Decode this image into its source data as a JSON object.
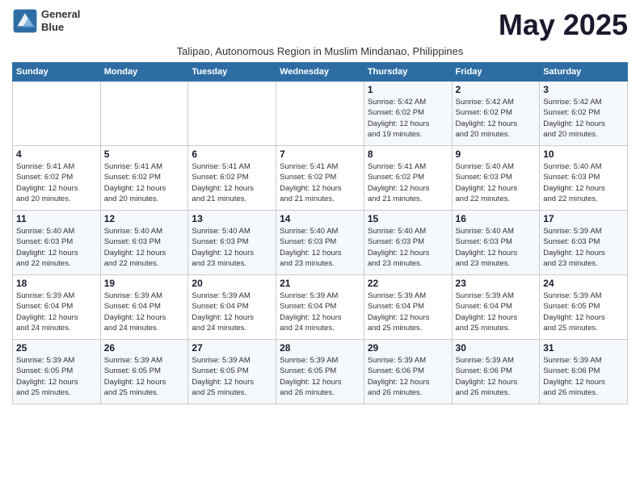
{
  "logo": {
    "line1": "General",
    "line2": "Blue"
  },
  "title": "May 2025",
  "subtitle": "Talipao, Autonomous Region in Muslim Mindanao, Philippines",
  "weekdays": [
    "Sunday",
    "Monday",
    "Tuesday",
    "Wednesday",
    "Thursday",
    "Friday",
    "Saturday"
  ],
  "weeks": [
    [
      {
        "day": "",
        "info": ""
      },
      {
        "day": "",
        "info": ""
      },
      {
        "day": "",
        "info": ""
      },
      {
        "day": "",
        "info": ""
      },
      {
        "day": "1",
        "info": "Sunrise: 5:42 AM\nSunset: 6:02 PM\nDaylight: 12 hours\nand 19 minutes."
      },
      {
        "day": "2",
        "info": "Sunrise: 5:42 AM\nSunset: 6:02 PM\nDaylight: 12 hours\nand 20 minutes."
      },
      {
        "day": "3",
        "info": "Sunrise: 5:42 AM\nSunset: 6:02 PM\nDaylight: 12 hours\nand 20 minutes."
      }
    ],
    [
      {
        "day": "4",
        "info": "Sunrise: 5:41 AM\nSunset: 6:02 PM\nDaylight: 12 hours\nand 20 minutes."
      },
      {
        "day": "5",
        "info": "Sunrise: 5:41 AM\nSunset: 6:02 PM\nDaylight: 12 hours\nand 20 minutes."
      },
      {
        "day": "6",
        "info": "Sunrise: 5:41 AM\nSunset: 6:02 PM\nDaylight: 12 hours\nand 21 minutes."
      },
      {
        "day": "7",
        "info": "Sunrise: 5:41 AM\nSunset: 6:02 PM\nDaylight: 12 hours\nand 21 minutes."
      },
      {
        "day": "8",
        "info": "Sunrise: 5:41 AM\nSunset: 6:02 PM\nDaylight: 12 hours\nand 21 minutes."
      },
      {
        "day": "9",
        "info": "Sunrise: 5:40 AM\nSunset: 6:03 PM\nDaylight: 12 hours\nand 22 minutes."
      },
      {
        "day": "10",
        "info": "Sunrise: 5:40 AM\nSunset: 6:03 PM\nDaylight: 12 hours\nand 22 minutes."
      }
    ],
    [
      {
        "day": "11",
        "info": "Sunrise: 5:40 AM\nSunset: 6:03 PM\nDaylight: 12 hours\nand 22 minutes."
      },
      {
        "day": "12",
        "info": "Sunrise: 5:40 AM\nSunset: 6:03 PM\nDaylight: 12 hours\nand 22 minutes."
      },
      {
        "day": "13",
        "info": "Sunrise: 5:40 AM\nSunset: 6:03 PM\nDaylight: 12 hours\nand 23 minutes."
      },
      {
        "day": "14",
        "info": "Sunrise: 5:40 AM\nSunset: 6:03 PM\nDaylight: 12 hours\nand 23 minutes."
      },
      {
        "day": "15",
        "info": "Sunrise: 5:40 AM\nSunset: 6:03 PM\nDaylight: 12 hours\nand 23 minutes."
      },
      {
        "day": "16",
        "info": "Sunrise: 5:40 AM\nSunset: 6:03 PM\nDaylight: 12 hours\nand 23 minutes."
      },
      {
        "day": "17",
        "info": "Sunrise: 5:39 AM\nSunset: 6:03 PM\nDaylight: 12 hours\nand 23 minutes."
      }
    ],
    [
      {
        "day": "18",
        "info": "Sunrise: 5:39 AM\nSunset: 6:04 PM\nDaylight: 12 hours\nand 24 minutes."
      },
      {
        "day": "19",
        "info": "Sunrise: 5:39 AM\nSunset: 6:04 PM\nDaylight: 12 hours\nand 24 minutes."
      },
      {
        "day": "20",
        "info": "Sunrise: 5:39 AM\nSunset: 6:04 PM\nDaylight: 12 hours\nand 24 minutes."
      },
      {
        "day": "21",
        "info": "Sunrise: 5:39 AM\nSunset: 6:04 PM\nDaylight: 12 hours\nand 24 minutes."
      },
      {
        "day": "22",
        "info": "Sunrise: 5:39 AM\nSunset: 6:04 PM\nDaylight: 12 hours\nand 25 minutes."
      },
      {
        "day": "23",
        "info": "Sunrise: 5:39 AM\nSunset: 6:04 PM\nDaylight: 12 hours\nand 25 minutes."
      },
      {
        "day": "24",
        "info": "Sunrise: 5:39 AM\nSunset: 6:05 PM\nDaylight: 12 hours\nand 25 minutes."
      }
    ],
    [
      {
        "day": "25",
        "info": "Sunrise: 5:39 AM\nSunset: 6:05 PM\nDaylight: 12 hours\nand 25 minutes."
      },
      {
        "day": "26",
        "info": "Sunrise: 5:39 AM\nSunset: 6:05 PM\nDaylight: 12 hours\nand 25 minutes."
      },
      {
        "day": "27",
        "info": "Sunrise: 5:39 AM\nSunset: 6:05 PM\nDaylight: 12 hours\nand 25 minutes."
      },
      {
        "day": "28",
        "info": "Sunrise: 5:39 AM\nSunset: 6:05 PM\nDaylight: 12 hours\nand 26 minutes."
      },
      {
        "day": "29",
        "info": "Sunrise: 5:39 AM\nSunset: 6:06 PM\nDaylight: 12 hours\nand 26 minutes."
      },
      {
        "day": "30",
        "info": "Sunrise: 5:39 AM\nSunset: 6:06 PM\nDaylight: 12 hours\nand 26 minutes."
      },
      {
        "day": "31",
        "info": "Sunrise: 5:39 AM\nSunset: 6:06 PM\nDaylight: 12 hours\nand 26 minutes."
      }
    ]
  ]
}
